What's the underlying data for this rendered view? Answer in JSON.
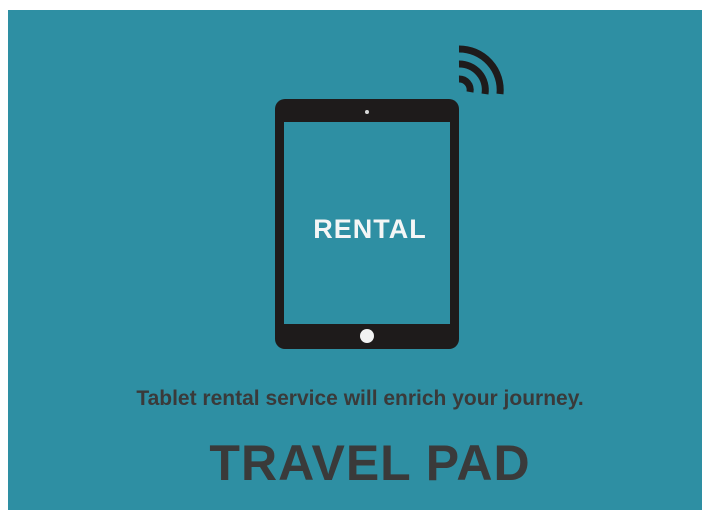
{
  "colors": {
    "background": "#2e8fa3",
    "tablet_body": "#1e1b1b",
    "text_dark": "#3a3a3a",
    "text_light": "#f4f6f6"
  },
  "illustration": {
    "device": "tablet-icon",
    "signal": "wifi-signal-icon",
    "screen_text": "RENTAL"
  },
  "tagline": "Tablet rental service will enrich your journey.",
  "brand_name": "TRAVEL PAD"
}
